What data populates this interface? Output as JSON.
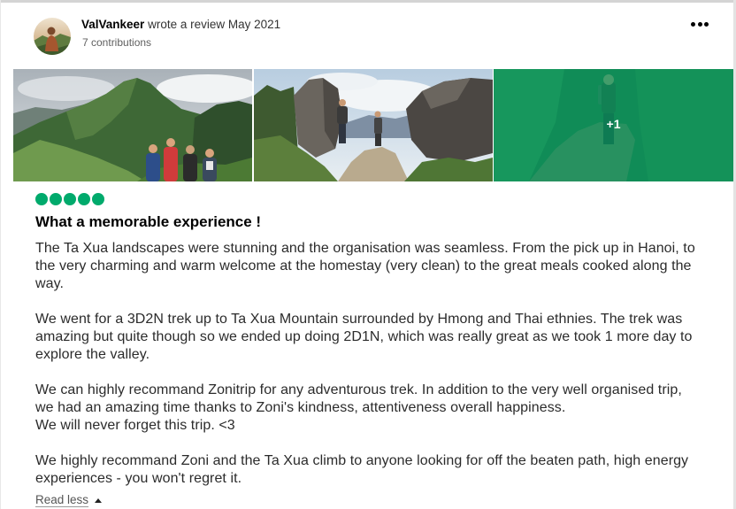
{
  "review": {
    "author": "ValVankeer",
    "action": "wrote a review",
    "date": "May 2021",
    "contributions": "7 contributions",
    "rating": {
      "value": 5,
      "max": 5
    },
    "title": "What a memorable experience !",
    "body": [
      [
        "The Ta Xua landscapes were stunning and the organisation was seamless. From the pick up in Hanoi, to",
        "the very charming and warm welcome at the homestay (very clean) to the great meals cooked along the",
        "way."
      ],
      [
        "We went for a 3D2N trek up to Ta Xua Mountain surrounded by Hmong and Thai ethnies. The trek was",
        "amazing but quite though so we ended up doing 2D1N, which was really great as we took 1 more day to",
        "explore the valley."
      ],
      [
        "We can highly recommand Zonitrip for any adventurous trek. In addition to the very well organised trip,",
        "we had an amazing time thanks to Zoni's kindness, attentiveness overall happiness.",
        "We will never forget this trip. <3"
      ],
      [
        "We highly recommand Zoni and the Ta Xua climb to anyone looking for off the beaten path, high energy",
        "experiences - you won't regret it."
      ]
    ],
    "toggle_label": "Read less"
  },
  "photos": {
    "overflow_label": "+1"
  },
  "icons": {
    "menu": "more-options-icon",
    "toggle": "caret-up-icon"
  },
  "colors": {
    "rating_bubble": "#00aa6c",
    "photo_overlay": "#00aa6c"
  }
}
